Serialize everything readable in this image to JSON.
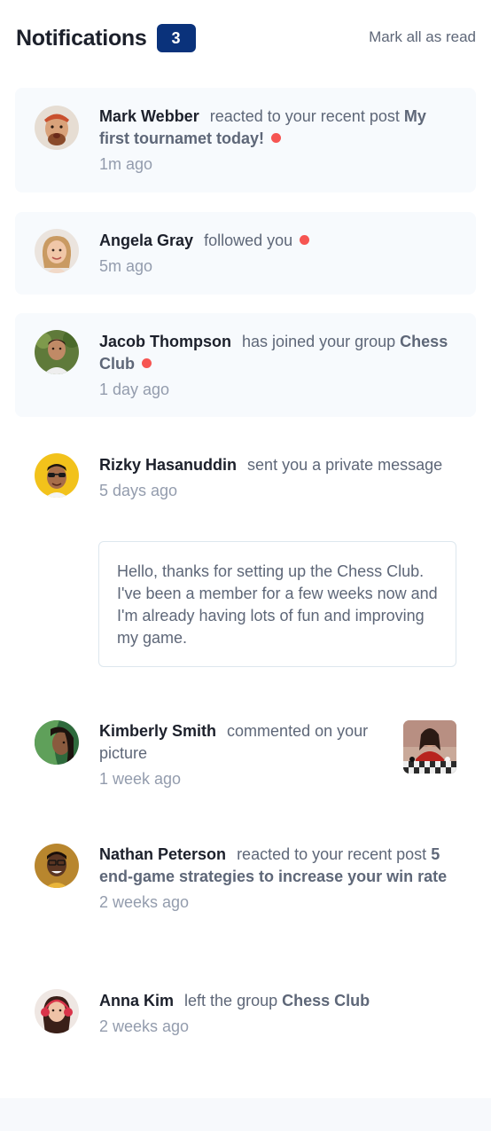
{
  "header": {
    "title": "Notifications",
    "unread_count": "3",
    "mark_all_label": "Mark all as read"
  },
  "notifications": [
    {
      "name": "Mark Webber",
      "action": "reacted to your recent post",
      "target": "My first tournamet today!",
      "time": "1m ago",
      "unread": true
    },
    {
      "name": "Angela Gray",
      "action": "followed you",
      "target": "",
      "time": "5m ago",
      "unread": true
    },
    {
      "name": "Jacob Thompson",
      "action": "has joined your group",
      "target": "Chess Club",
      "time": "1 day ago",
      "unread": true
    },
    {
      "name": "Rizky Hasanuddin",
      "action": "sent you a private message",
      "target": "",
      "time": "5 days ago",
      "unread": false,
      "message": "Hello, thanks for setting up the Chess Club. I've been a member for a few weeks now and I'm already having lots of fun and improving my game."
    },
    {
      "name": "Kimberly Smith",
      "action": "commented on your picture",
      "target": "",
      "time": "1 week ago",
      "unread": false
    },
    {
      "name": "Nathan Peterson",
      "action": "reacted to your recent post",
      "target": "5 end-game strategies to increase your win rate",
      "time": "2 weeks ago",
      "unread": false
    },
    {
      "name": "Anna Kim",
      "action": "left the group",
      "target": "Chess Club",
      "time": "2 weeks ago",
      "unread": false
    }
  ],
  "colors": {
    "accent": "#0a327b",
    "unread_dot": "#f65552",
    "unread_bg": "#f7fafd",
    "heading": "#1c202b",
    "text": "#5e6778",
    "muted": "#939cad"
  }
}
